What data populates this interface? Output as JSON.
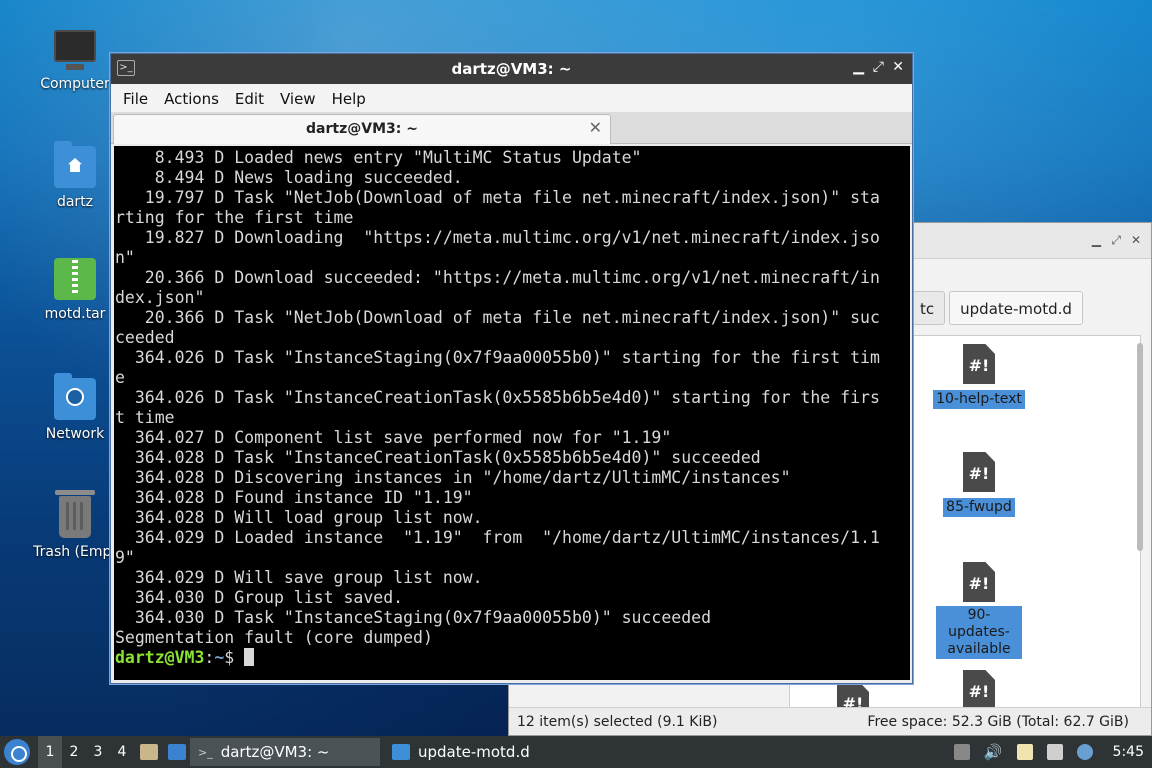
{
  "desktop": {
    "icons": [
      {
        "label": "Computer"
      },
      {
        "label": "dartz"
      },
      {
        "label": "motd.tar"
      },
      {
        "label": "Network"
      },
      {
        "label": "Trash (Empt"
      }
    ]
  },
  "terminal": {
    "title": "dartz@VM3: ~",
    "menu": [
      "File",
      "Actions",
      "Edit",
      "View",
      "Help"
    ],
    "tab_label": "dartz@VM3: ~",
    "lines": [
      "    8.493 D Loaded news entry \"MultiMC Status Update\"",
      "    8.494 D News loading succeeded.",
      "   19.797 D Task \"NetJob(Download of meta file net.minecraft/index.json)\" sta",
      "rting for the first time",
      "   19.827 D Downloading  \"https://meta.multimc.org/v1/net.minecraft/index.jso",
      "n\"",
      "   20.366 D Download succeeded: \"https://meta.multimc.org/v1/net.minecraft/in",
      "dex.json\"",
      "   20.366 D Task \"NetJob(Download of meta file net.minecraft/index.json)\" suc",
      "ceeded",
      "  364.026 D Task \"InstanceStaging(0x7f9aa00055b0)\" starting for the first tim",
      "e",
      "  364.026 D Task \"InstanceCreationTask(0x5585b6b5e4d0)\" starting for the firs",
      "t time",
      "  364.027 D Component list save performed now for \"1.19\"",
      "  364.028 D Task \"InstanceCreationTask(0x5585b6b5e4d0)\" succeeded",
      "  364.028 D Discovering instances in \"/home/dartz/UltimMC/instances\"",
      "  364.028 D Found instance ID \"1.19\"",
      "  364.028 D Will load group list now.",
      "  364.029 D Loaded instance  \"1.19\"  from  \"/home/dartz/UltimMC/instances/1.1",
      "9\"",
      "  364.029 D Will save group list now.",
      "  364.030 D Group list saved.",
      "  364.030 D Task \"InstanceStaging(0x7f9aa00055b0)\" succeeded",
      "Segmentation fault (core dumped)"
    ],
    "prompt_user": "dartz@VM3",
    "prompt_sep": ":",
    "prompt_path": "~",
    "prompt_symbol": "$ "
  },
  "file_manager": {
    "path_crumbs": [
      "tc",
      "update-motd.d"
    ],
    "files": [
      "10-help-text",
      "85-fwupd",
      "90-updates-available",
      "",
      ""
    ],
    "file_glyph": "#!",
    "status_left": "12 item(s) selected (9.1 KiB)",
    "status_right": "Free space: 52.3 GiB (Total: 62.7 GiB)"
  },
  "taskbar": {
    "workspaces": [
      "1",
      "2",
      "3",
      "4"
    ],
    "windows": [
      "dartz@VM3: ~",
      "update-motd.d"
    ],
    "clock": "5:45"
  }
}
